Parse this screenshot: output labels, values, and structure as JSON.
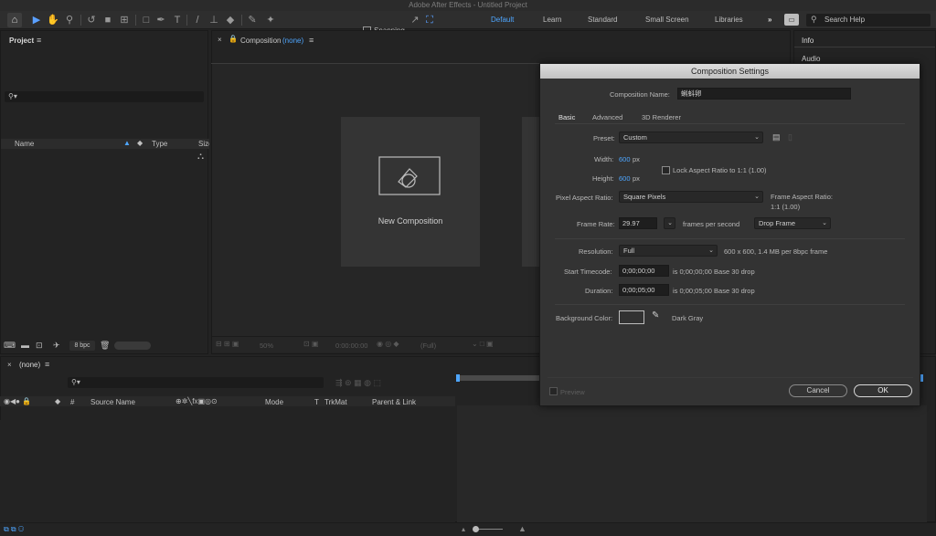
{
  "window": {
    "title": "Adobe After Effects - Untitled Project"
  },
  "toolbar": {
    "snapping_label": "Snapping",
    "workspaces": [
      "Default",
      "Learn",
      "Standard",
      "Small Screen",
      "Libraries"
    ],
    "more_label": "»",
    "search_placeholder": "Search Help"
  },
  "project_panel": {
    "title": "Project",
    "columns": {
      "name": "Name",
      "type": "Type",
      "size": "Size"
    },
    "bpc_label": "8 bpc"
  },
  "composition_panel": {
    "tab_prefix": "Composition",
    "tab_name": "(none)",
    "card_label": "New Composition",
    "footer": {
      "zoom": "50%",
      "timecode": "0:00:00:00",
      "resolution": "(Full)"
    }
  },
  "right_panel": {
    "items": [
      "Info",
      "Audio"
    ]
  },
  "timeline": {
    "tab": "(none)",
    "columns": {
      "hash": "#",
      "source_name": "Source Name",
      "mode": "Mode",
      "t": "T",
      "trkmat": "TrkMat",
      "parent": "Parent & Link"
    }
  },
  "dialog": {
    "title": "Composition Settings",
    "comp_name_label": "Composition Name:",
    "comp_name_value": "蝌蚪卵",
    "tabs": [
      "Basic",
      "Advanced",
      "3D Renderer"
    ],
    "active_tab": "Basic",
    "preset_label": "Preset:",
    "preset_value": "Custom",
    "width_label": "Width:",
    "width_value": "600",
    "height_label": "Height:",
    "height_value": "600",
    "px_unit": "px",
    "lock_aspect_label": "Lock Aspect Ratio to 1:1 (1.00)",
    "par_label": "Pixel Aspect Ratio:",
    "par_value": "Square Pixels",
    "frame_aspect_label": "Frame Aspect Ratio:",
    "frame_aspect_value": "1:1 (1.00)",
    "frame_rate_label": "Frame Rate:",
    "frame_rate_value": "29.97",
    "fps_label": "frames per second",
    "drop_frame_value": "Drop Frame",
    "resolution_label": "Resolution:",
    "resolution_value": "Full",
    "resolution_info": "600 x 600, 1.4 MB per 8bpc frame",
    "start_tc_label": "Start Timecode:",
    "start_tc_value": "0;00;00;00",
    "start_tc_info": "is 0;00;00;00  Base 30  drop",
    "duration_label": "Duration:",
    "duration_value": "0;00;05;00",
    "duration_info": "is 0;00;05;00  Base 30  drop",
    "bg_color_label": "Background Color:",
    "bg_color_name": "Dark Gray",
    "preview_label": "Preview",
    "cancel_label": "Cancel",
    "ok_label": "OK"
  }
}
